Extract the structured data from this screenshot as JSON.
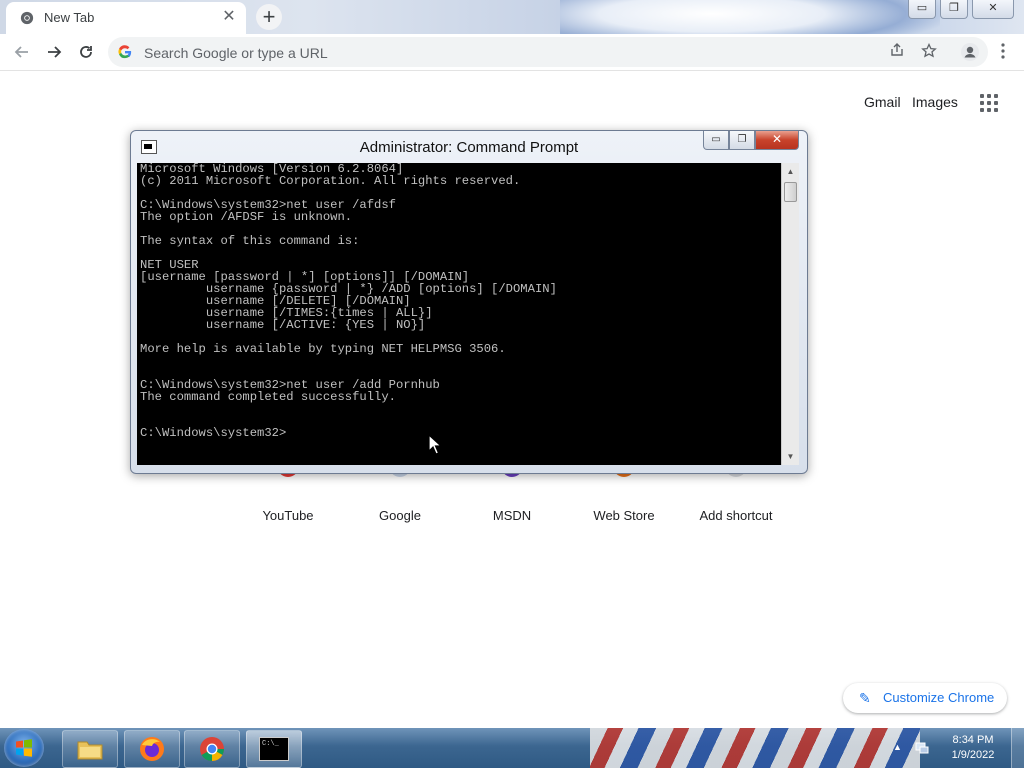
{
  "browser": {
    "tab_title": "New Tab",
    "tab_close": "✕",
    "new_tab": "+",
    "window_buttons": [
      "▭",
      "❐",
      "✕"
    ],
    "omnibox_placeholder": "Search Google or type a URL"
  },
  "ntp": {
    "top_links": [
      "Gmail",
      "Images"
    ],
    "shortcuts": [
      "YouTube",
      "Google",
      "MSDN",
      "Web Store",
      "Add shortcut"
    ],
    "shortcut_colors": [
      "#e53935",
      "#1a73e8",
      "#6a3fc1",
      "#e8711a",
      "#9aa0a6"
    ],
    "customize_label": "Customize Chrome"
  },
  "cmd": {
    "title": "Administrator: Command Prompt",
    "buttons": [
      "▭",
      "❐",
      "✕"
    ],
    "lines": [
      "Microsoft Windows [Version 6.2.8064]",
      "(c) 2011 Microsoft Corporation. All rights reserved.",
      "",
      "C:\\Windows\\system32>net user /afdsf",
      "The option /AFDSF is unknown.",
      "",
      "The syntax of this command is:",
      "",
      "NET USER",
      "[username [password | *] [options]] [/DOMAIN]",
      "         username {password | *} /ADD [options] [/DOMAIN]",
      "         username [/DELETE] [/DOMAIN]",
      "         username [/TIMES:{times | ALL}]",
      "         username [/ACTIVE: {YES | NO}]",
      "",
      "More help is available by typing NET HELPMSG 3506.",
      "",
      "",
      "C:\\Windows\\system32>net user /add Pornhub",
      "The command completed successfully.",
      "",
      "",
      "C:\\Windows\\system32>"
    ]
  },
  "taskbar": {
    "time": "8:34 PM",
    "date": "1/9/2022",
    "cmd_button_text": "C:\\_"
  },
  "colors": {
    "accent": "#1a73e8",
    "console_bg": "#000000",
    "console_fg": "#c0c0c0"
  }
}
